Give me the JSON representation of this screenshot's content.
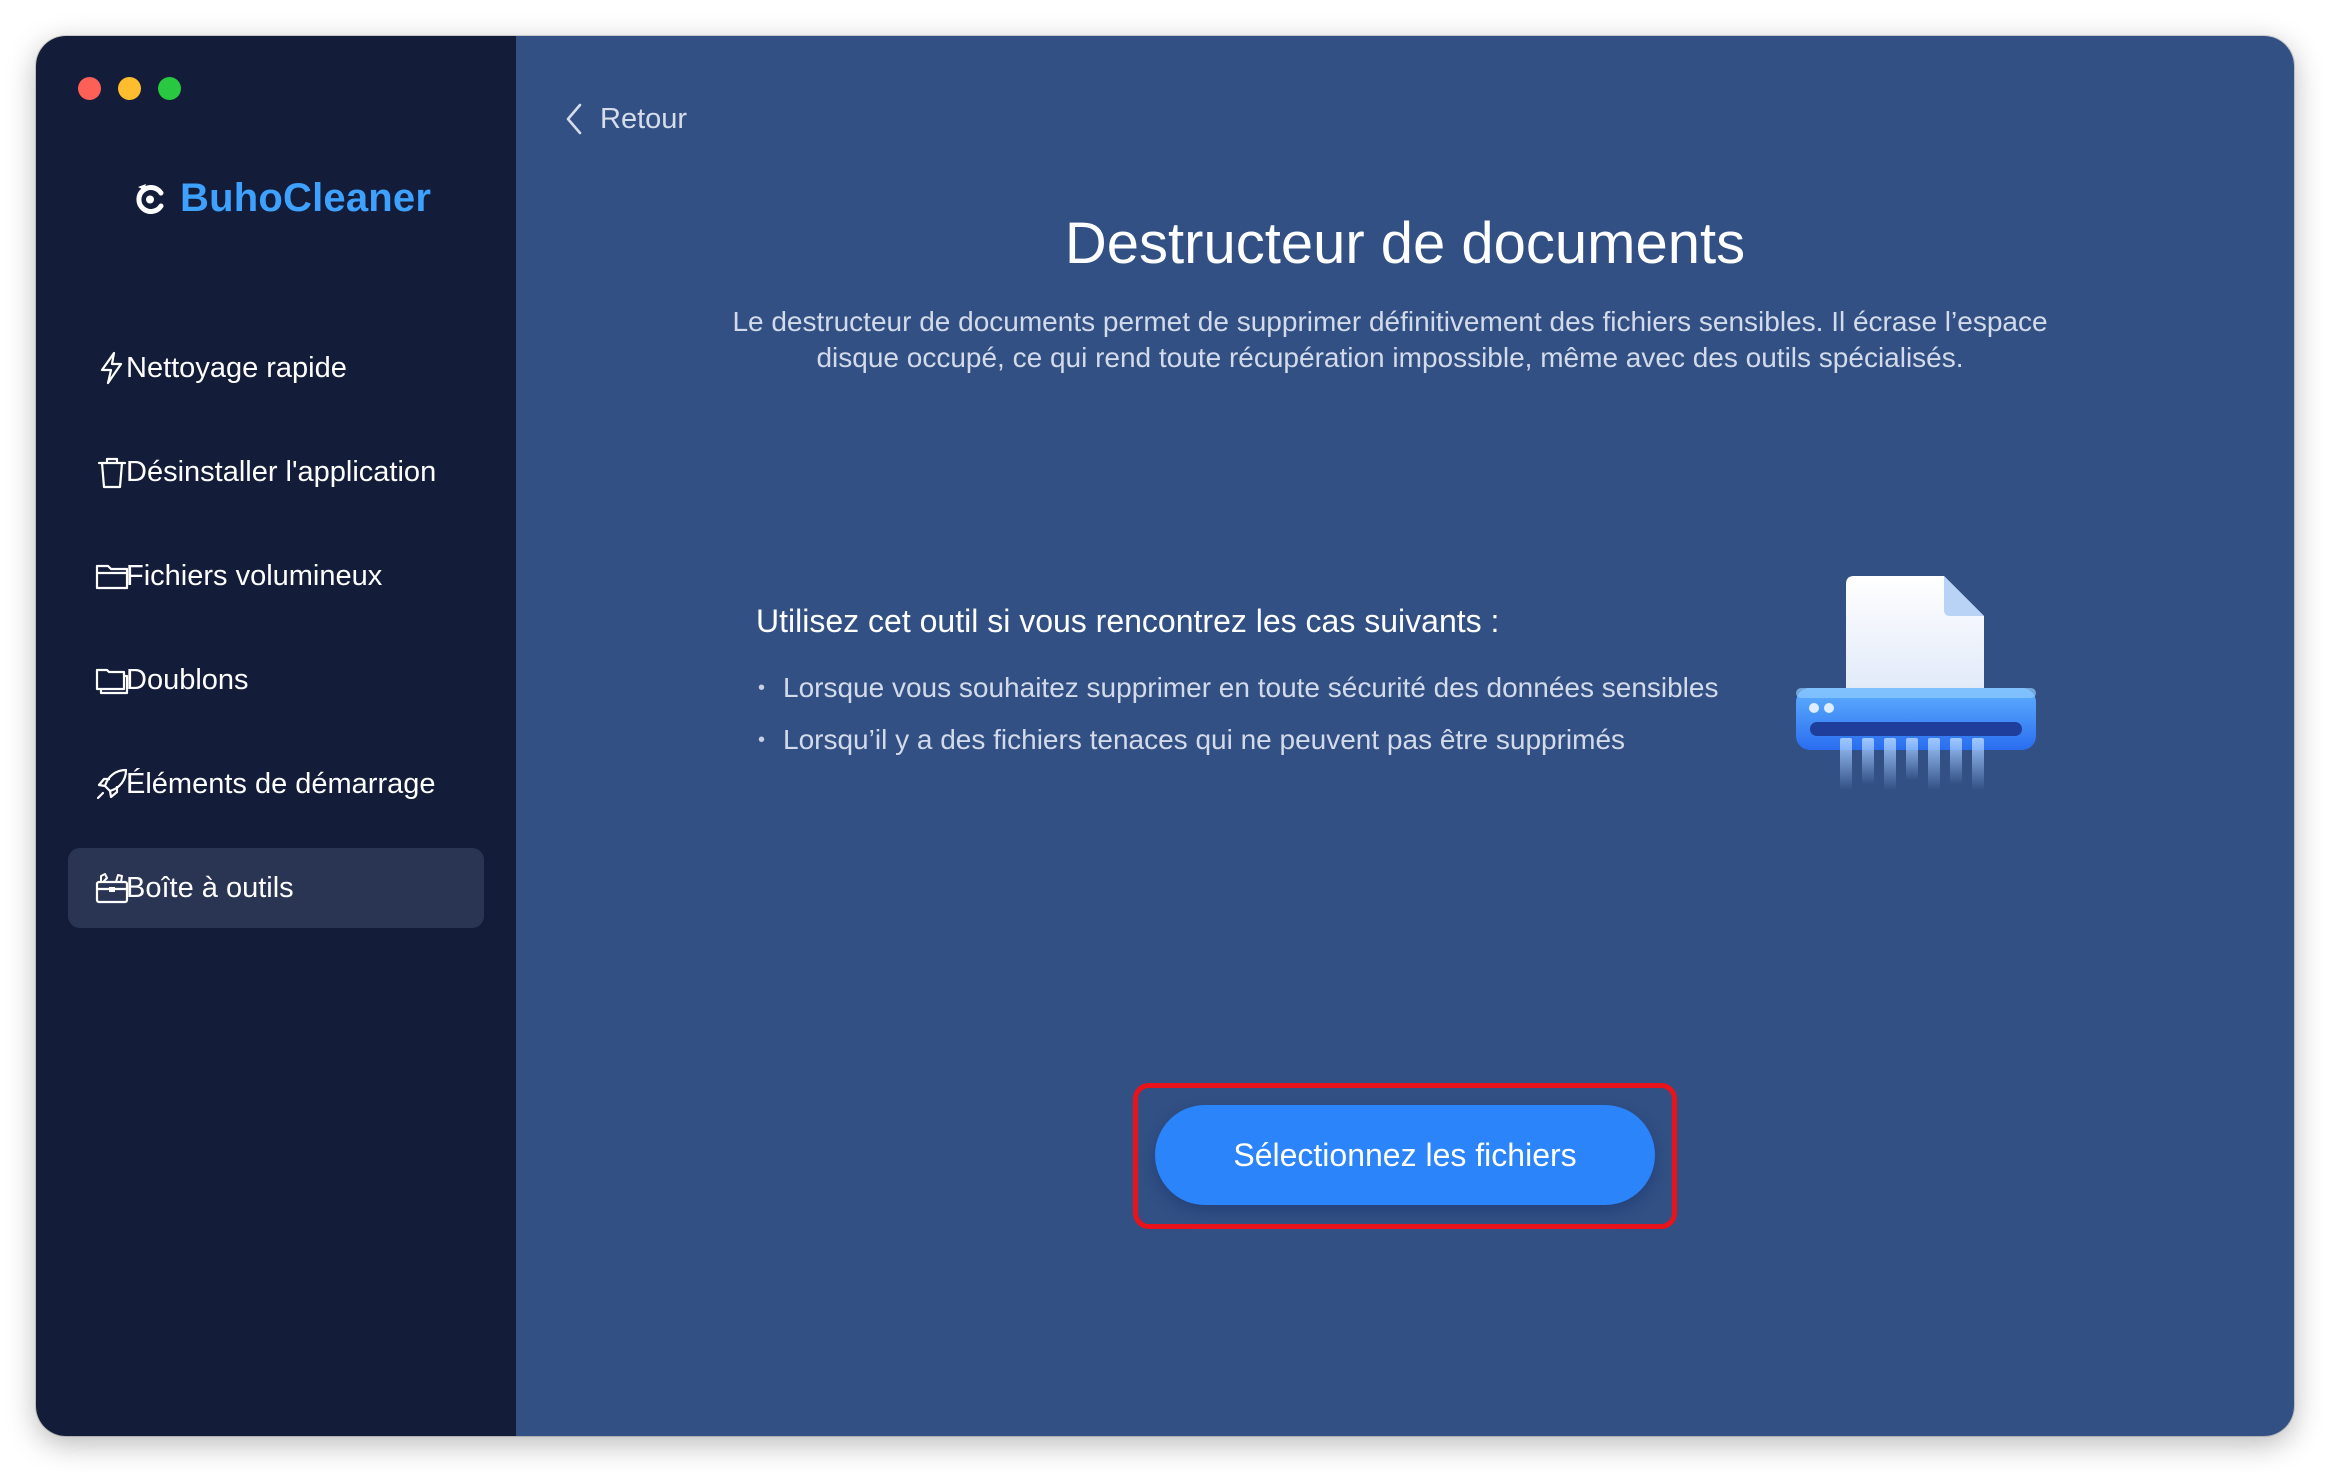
{
  "window": {
    "traffic_lights": [
      "close",
      "minimize",
      "zoom"
    ]
  },
  "sidebar": {
    "brand": {
      "name": "BuhoCleaner",
      "icon": "buho-logo-icon",
      "color": "#3ea0ff"
    },
    "items": [
      {
        "label": "Nettoyage rapide",
        "icon": "lightning-icon",
        "active": false
      },
      {
        "label": "Désinstaller l'application",
        "icon": "trash-icon",
        "active": false
      },
      {
        "label": "Fichiers volumineux",
        "icon": "folder-icon",
        "active": false
      },
      {
        "label": "Doublons",
        "icon": "duplicate-folder-icon",
        "active": false
      },
      {
        "label": "Éléments de démarrage",
        "icon": "rocket-icon",
        "active": false
      },
      {
        "label": "Boîte à outils",
        "icon": "toolbox-icon",
        "active": true
      }
    ]
  },
  "main": {
    "back_label": "Retour",
    "title": "Destructeur de documents",
    "description": "Le destructeur de documents permet de supprimer définitivement des fichiers sensibles. Il écrase l’espace disque occupé, ce qui rend toute récupération impossible, même avec des outils spécialisés.",
    "usecase_heading": "Utilisez cet outil si vous rencontrez les cas suivants :",
    "usecases": [
      "Lorsque vous souhaitez supprimer en toute sécurité des données sensibles",
      "Lorsqu’il y a des fichiers tenaces qui ne peuvent pas être supprimés"
    ],
    "illustration": "document-shredder-icon",
    "cta_label": "Sélectionnez les fichiers"
  },
  "colors": {
    "sidebar_bg": "#131c38",
    "main_bg": "#325084",
    "accent": "#2b84f9",
    "highlight": "#e8131b"
  }
}
